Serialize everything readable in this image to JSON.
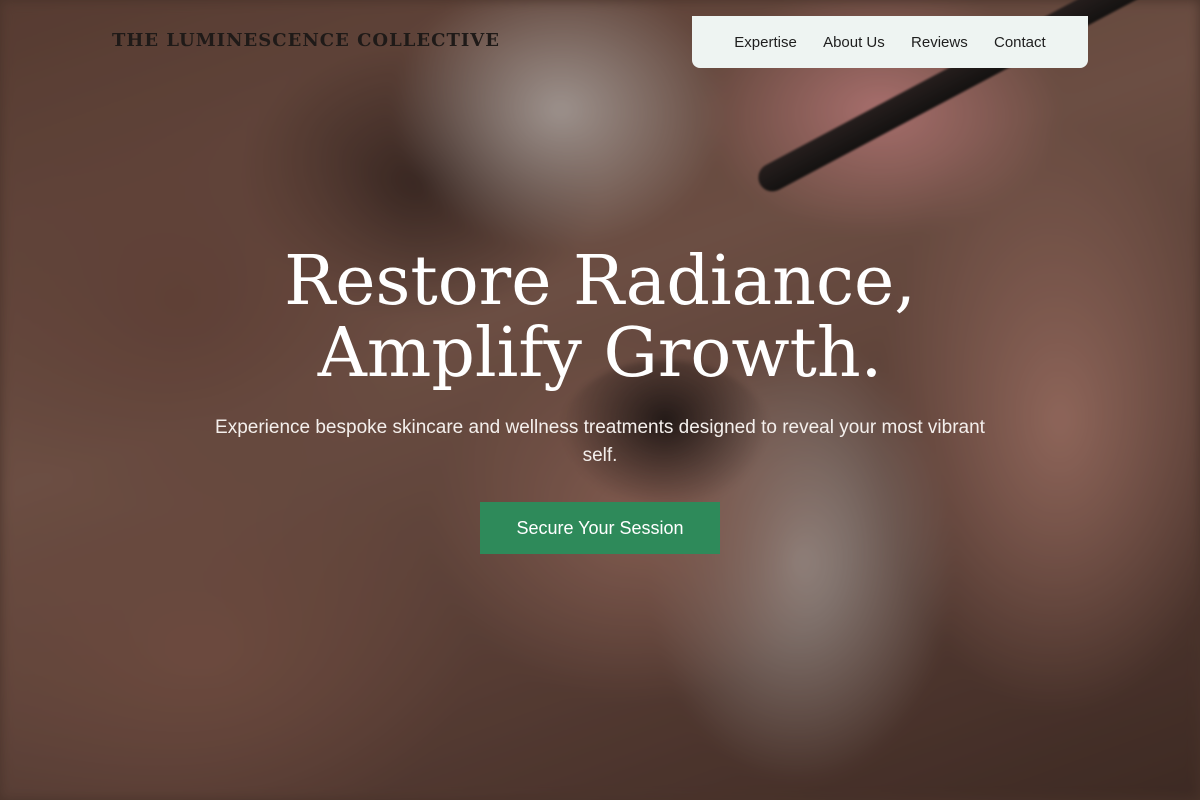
{
  "brand": {
    "name": "THE LUMINESCENCE COLLECTIVE"
  },
  "nav": {
    "items": [
      {
        "label": "Expertise"
      },
      {
        "label": "About Us"
      },
      {
        "label": "Reviews"
      },
      {
        "label": "Contact"
      }
    ]
  },
  "hero": {
    "headline_line1": "Restore Radiance,",
    "headline_line2": "Amplify Growth.",
    "subtext": "Experience bespoke skincare and wellness treatments designed to reveal your most vibrant self.",
    "cta_label": "Secure Your Session"
  },
  "colors": {
    "accent": "#2e8a5a",
    "nav_background": "#eef4f2",
    "headline_text": "#ffffff"
  }
}
